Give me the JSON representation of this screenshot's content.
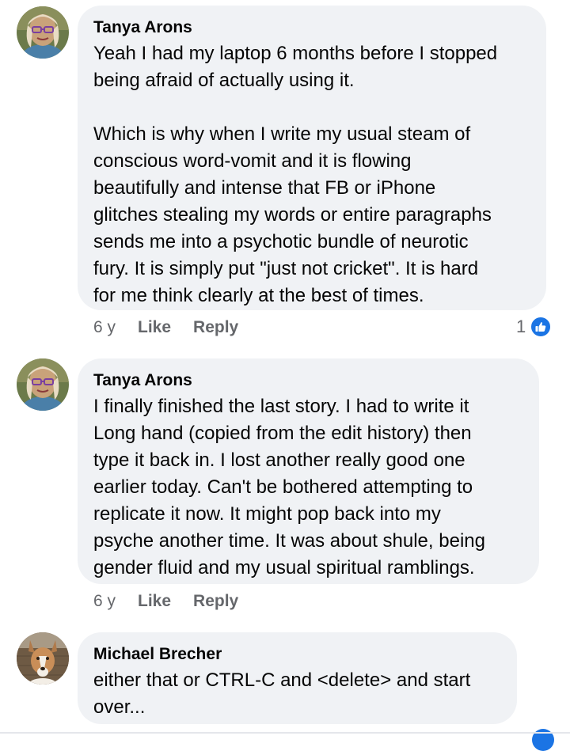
{
  "comments": [
    {
      "author": "Tanya Arons",
      "text": "Yeah I had my laptop 6 months before I stopped\nbeing afraid of actually using it.\n\nWhich is why when I write my usual steam of\nconscious word-vomit and it is flowing\nbeautifully and intense that FB or iPhone\nglitches stealing my words or entire paragraphs\nsends me into a psychotic bundle of neurotic\nfury.  It is simply put \"just not cricket\". It is hard\nfor me think clearly at the best of times.",
      "time": "6 y",
      "like_label": "Like",
      "reply_label": "Reply",
      "reaction_count": "1",
      "reaction_icon": "thumbs-up-icon"
    },
    {
      "author": "Tanya Arons",
      "text": "I finally finished the last story.  I had to write it\nLong hand (copied from the edit history) then\ntype it back in.  I lost another really good one\nearlier today.  Can't be bothered attempting to\nreplicate it now.  It might pop back into my\npsyche another time.  It was about shule, being\ngender fluid and my usual spiritual ramblings.",
      "time": "6 y",
      "like_label": "Like",
      "reply_label": "Reply"
    },
    {
      "author": "Michael Brecher",
      "text": "either that or CTRL-C and <delete> and start\nover..."
    }
  ],
  "colors": {
    "bubble": "#f0f2f5",
    "meta_text": "#65676b",
    "like_blue": "#1b74e4"
  }
}
